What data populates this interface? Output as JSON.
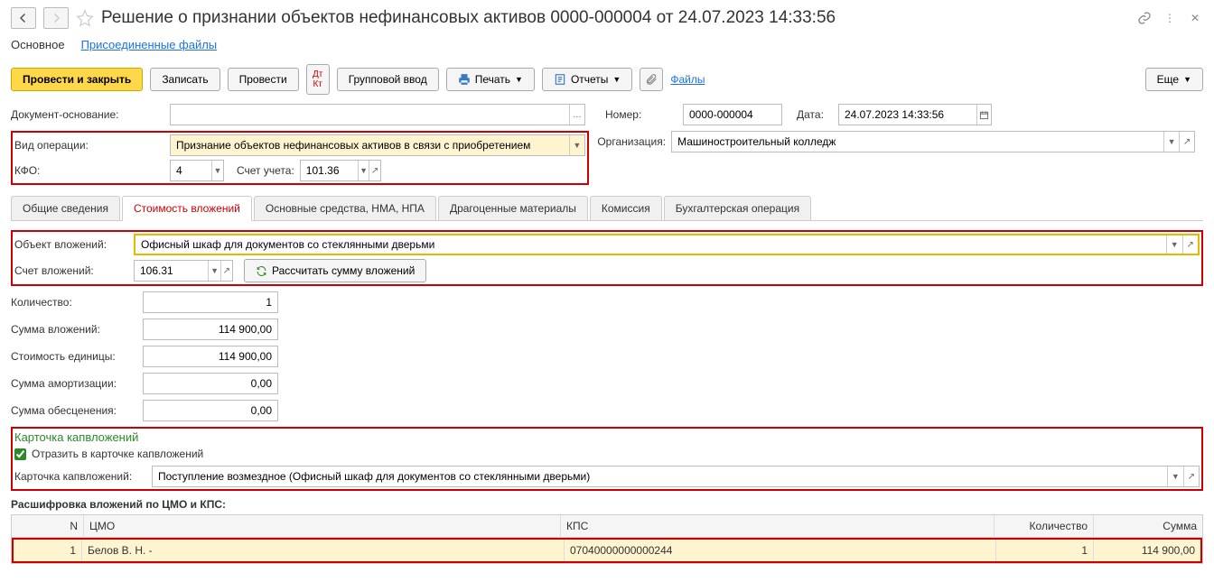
{
  "header": {
    "title": "Решение о признании объектов нефинансовых активов 0000-000004 от 24.07.2023 14:33:56"
  },
  "links": {
    "main": "Основное",
    "attached": "Присоединенные файлы"
  },
  "toolbar": {
    "post_close": "Провести и закрыть",
    "save": "Записать",
    "post": "Провести",
    "group_input": "Групповой ввод",
    "print": "Печать",
    "reports": "Отчеты",
    "files": "Файлы",
    "more": "Еще"
  },
  "fields": {
    "doc_basis_lbl": "Документ-основание:",
    "doc_basis_val": "",
    "number_lbl": "Номер:",
    "number_val": "0000-000004",
    "date_lbl": "Дата:",
    "date_val": "24.07.2023 14:33:56",
    "op_type_lbl": "Вид операции:",
    "op_type_val": "Признание объектов нефинансовых активов в связи с приобретением",
    "org_lbl": "Организация:",
    "org_val": "Машиностроительный колледж",
    "kfo_lbl": "КФО:",
    "kfo_val": "4",
    "account_lbl": "Счет учета:",
    "account_val": "101.36"
  },
  "tabs": [
    "Общие сведения",
    "Стоимость вложений",
    "Основные средства, НМА, НПА",
    "Драгоценные материалы",
    "Комиссия",
    "Бухгалтерская операция"
  ],
  "tab2": {
    "object_lbl": "Объект вложений:",
    "object_val": "Офисный шкаф для документов со стеклянными дверьми",
    "inv_account_lbl": "Счет вложений:",
    "inv_account_val": "106.31",
    "recalc": "Рассчитать сумму вложений",
    "qty_lbl": "Количество:",
    "qty_val": "1",
    "inv_sum_lbl": "Сумма вложений:",
    "inv_sum_val": "114 900,00",
    "unit_cost_lbl": "Стоимость единицы:",
    "unit_cost_val": "114 900,00",
    "amort_lbl": "Сумма амортизации:",
    "amort_val": "0,00",
    "impair_lbl": "Сумма обесценения:",
    "impair_val": "0,00",
    "card_title": "Карточка капвложений",
    "card_check": "Отразить в карточке капвложений",
    "card_lbl": "Карточка капвложений:",
    "card_val": "Поступление возмездное (Офисный шкаф для документов со стеклянными дверьми)",
    "table_title": "Расшифровка вложений по ЦМО и КПС:",
    "cols": {
      "n": "N",
      "cmo": "ЦМО",
      "kps": "КПС",
      "qty": "Количество",
      "sum": "Сумма"
    },
    "row": {
      "n": "1",
      "cmo": "Белов В. Н. -",
      "kps": "07040000000000244",
      "qty": "1",
      "sum": "114 900,00"
    }
  }
}
